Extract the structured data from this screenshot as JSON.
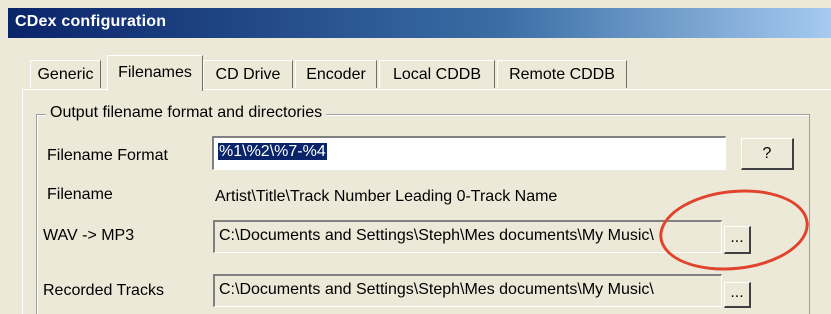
{
  "window": {
    "title": "CDex configuration"
  },
  "tabs": [
    {
      "label": "Generic",
      "active": false
    },
    {
      "label": "Filenames",
      "active": true
    },
    {
      "label": "CD Drive",
      "active": false
    },
    {
      "label": "Encoder",
      "active": false
    },
    {
      "label": "Local CDDB",
      "active": false
    },
    {
      "label": "Remote CDDB",
      "active": false
    }
  ],
  "group": {
    "title": "Output filename format and directories",
    "filename_format": {
      "label": "Filename Format",
      "value": "%1\\%2\\%7-%4",
      "help_label": "?"
    },
    "filename": {
      "label": "Filename",
      "preview": "Artist\\Title\\Track Number Leading 0-Track Name"
    },
    "wav_mp3": {
      "label": "WAV -> MP3",
      "path": "C:\\Documents and Settings\\Steph\\Mes documents\\My Music\\",
      "browse_label": "..."
    },
    "recorded": {
      "label": "Recorded Tracks",
      "path": "C:\\Documents and Settings\\Steph\\Mes documents\\My Music\\",
      "browse_label": "..."
    }
  },
  "colors": {
    "annotation_circle": "#e0442c",
    "title_bar": "#0a246a"
  }
}
